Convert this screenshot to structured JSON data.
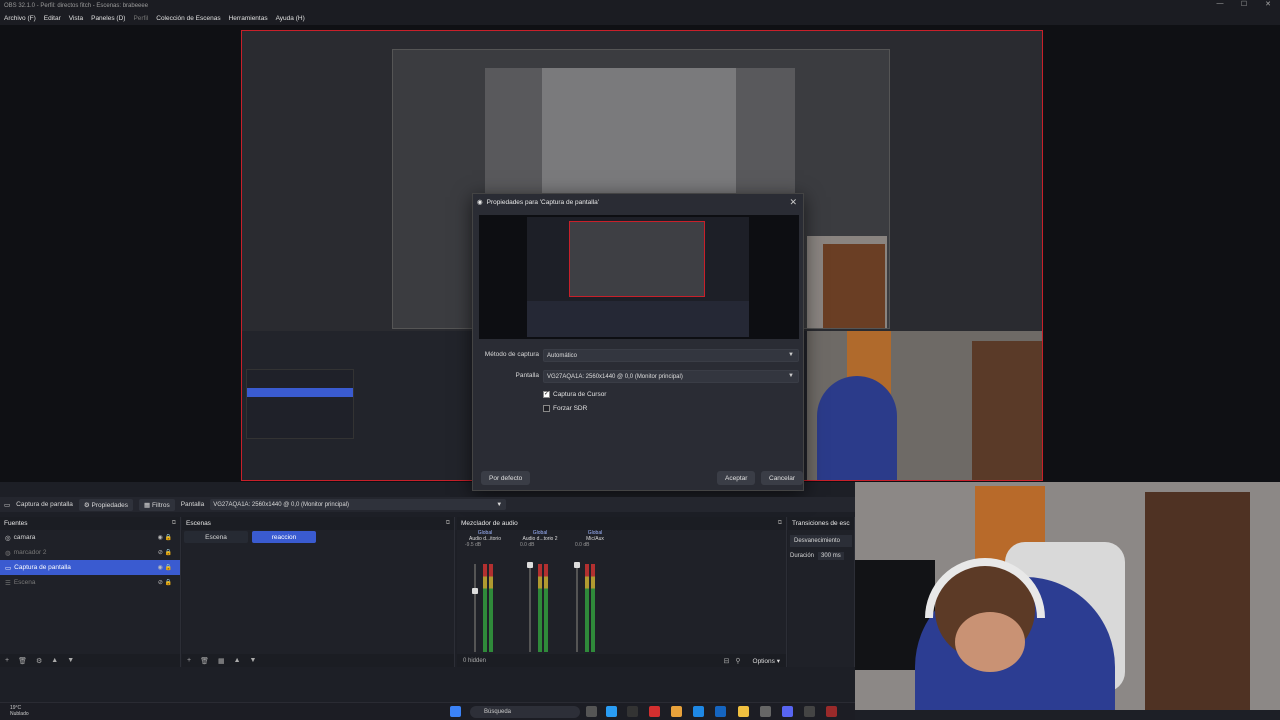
{
  "window": {
    "title": "OBS 32.1.0 - Perfil: directos fitch - Escenas: brabeeee"
  },
  "menu": [
    "Archivo (F)",
    "Editar",
    "Vista",
    "Paneles (D)",
    "Perfil",
    "Colección de Escenas",
    "Herramientas",
    "Ayuda (H)"
  ],
  "dialog": {
    "title": "Propiedades para 'Captura de pantalla'",
    "method_label": "Método de captura",
    "method_value": "Automático",
    "screen_label": "Pantalla",
    "screen_value": "VG27AQA1A: 2560x1440 @ 0,0 (Monitor principal)",
    "cursor_label": "Captura de Cursor",
    "cursor_checked": true,
    "sdr_label": "Forzar SDR",
    "sdr_checked": false,
    "default_btn": "Por defecto",
    "accept_btn": "Aceptar",
    "cancel_btn": "Cancelar"
  },
  "toolbar": {
    "source_name": "Captura de pantalla",
    "properties": "Propiedades",
    "filters": "Filtros",
    "screen_label": "Pantalla",
    "screen_value": "VG27AQA1A: 2560x1440 @ 0,0 (Monitor principal)"
  },
  "sources": {
    "title": "Fuentes",
    "items": [
      {
        "label": "camara",
        "visible": true
      },
      {
        "label": "marcador 2",
        "visible": false
      },
      {
        "label": "Captura de pantalla",
        "visible": true,
        "selected": true
      },
      {
        "label": "Escena",
        "visible": false
      }
    ]
  },
  "scenes": {
    "title": "Escenas",
    "items": [
      "Escena",
      "reaccion"
    ],
    "active": "reaccion"
  },
  "mixer": {
    "title": "Mezclador de audio",
    "channels": [
      {
        "tag": "Global",
        "name": "Audio d...itorio",
        "db": "-9.5 dB"
      },
      {
        "tag": "Global",
        "name": "Audio d...torio 2",
        "db": "0.0 dB"
      },
      {
        "tag": "Global",
        "name": "Mic/Aux",
        "db": "0.0 dB"
      }
    ],
    "hidden": "0 hidden",
    "options": "Options"
  },
  "transitions": {
    "title": "Transiciones de esc",
    "type": "Desvanecimiento",
    "duration_label": "Duración",
    "duration_value": "300 ms"
  },
  "taskbar": {
    "temp": "19°C",
    "weather": "Nublado",
    "search": "Búsqueda"
  }
}
